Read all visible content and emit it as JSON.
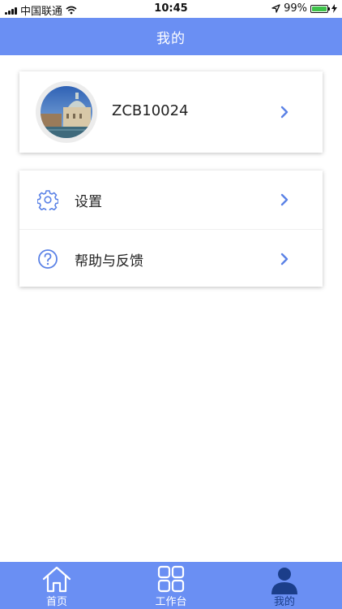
{
  "status_bar": {
    "carrier": "中国联通",
    "time": "10:45",
    "battery": "99%",
    "battery_level": 0.99,
    "icons": [
      "signal-icon",
      "wifi-icon",
      "location-arrow-icon",
      "battery-icon",
      "charging-bolt-icon"
    ]
  },
  "header": {
    "title": "我的"
  },
  "profile": {
    "username": "ZCB10024",
    "avatar_icon": "avatar-venice-photo"
  },
  "menu": {
    "items": [
      {
        "label": "设置",
        "icon": "gear-icon"
      },
      {
        "label": "帮助与反馈",
        "icon": "help-circle-icon"
      }
    ]
  },
  "tabbar": {
    "items": [
      {
        "label": "首页",
        "icon": "home-icon",
        "active": false
      },
      {
        "label": "工作台",
        "icon": "grid-icon",
        "active": false
      },
      {
        "label": "我的",
        "icon": "user-icon",
        "active": true
      }
    ]
  },
  "colors": {
    "primary": "#6a8ff3",
    "active_tab": "#1b3e8a",
    "icon_blue": "#5b82e6",
    "battery_green": "#3dc34a"
  }
}
